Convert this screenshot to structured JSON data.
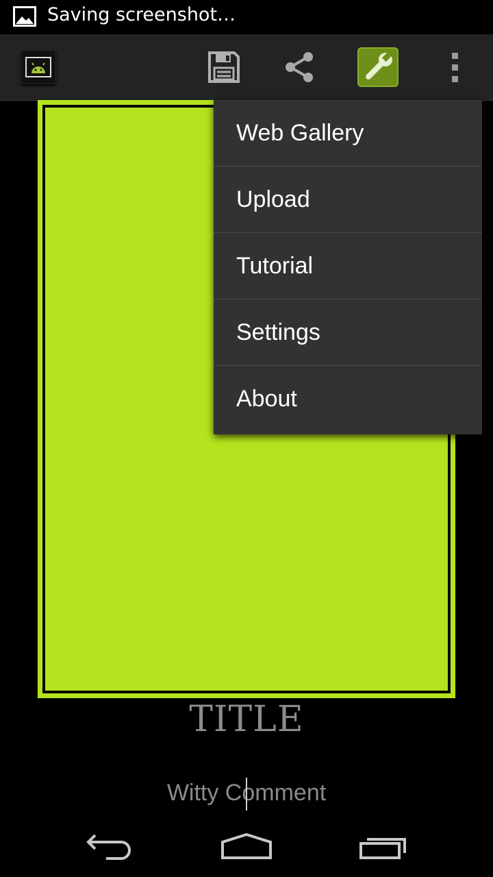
{
  "status_bar": {
    "notification_icon": "image-icon",
    "text": "Saving screenshot…"
  },
  "action_bar": {
    "app_icon": "android-app-icon",
    "actions": [
      {
        "name": "save",
        "icon": "floppy-disk-icon"
      },
      {
        "name": "share",
        "icon": "share-icon"
      },
      {
        "name": "tools",
        "icon": "wrench-icon"
      },
      {
        "name": "more",
        "icon": "overflow-menu-icon"
      }
    ]
  },
  "overflow_menu": {
    "items": [
      {
        "label": "Web Gallery"
      },
      {
        "label": "Upload"
      },
      {
        "label": "Tutorial"
      },
      {
        "label": "Settings"
      },
      {
        "label": "About"
      }
    ]
  },
  "canvas": {
    "fill_color": "#b5e41e",
    "border_color": "#000000",
    "title": "TITLE",
    "comment": "Witty Comment"
  },
  "nav_bar": {
    "buttons": [
      "back-icon",
      "home-icon",
      "recent-apps-icon"
    ]
  },
  "colors": {
    "accent": "#b5e41e",
    "tools_button": "#6e8f18",
    "menu_bg": "#323232",
    "action_bar_bg": "#232323"
  }
}
